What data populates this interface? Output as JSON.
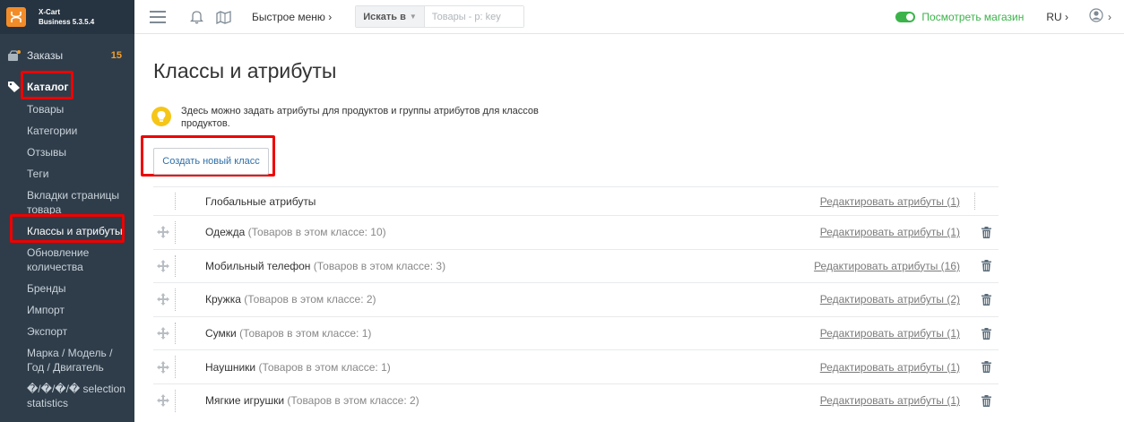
{
  "brand": {
    "name": "X-Cart",
    "edition": "Business 5.3.5.4"
  },
  "sidebar": {
    "orders_label": "Заказы",
    "orders_count": "15",
    "catalog_label": "Каталог",
    "items": [
      "Товары",
      "Категории",
      "Отзывы",
      "Теги",
      "Вкладки страницы товара",
      "Классы и атрибуты",
      "Обновление количества",
      "Бренды",
      "Импорт",
      "Экспорт",
      "Марка / Модель / Год / Двигатель",
      "�/�/�/� selection statistics"
    ],
    "active_item": "Классы и атрибуты"
  },
  "topbar": {
    "quick_menu": "Быстрое меню ›",
    "search_in": "Искать в",
    "search_placeholder": "Товары - p: key",
    "view_store": "Посмотреть магазин",
    "language": "RU ›"
  },
  "page": {
    "title": "Классы и атрибуты",
    "hint": "Здесь можно задать атрибуты для продуктов и группы атрибутов для классов продуктов.",
    "create_button": "Создать новый класс"
  },
  "classes": [
    {
      "name": "Глобальные атрибуты",
      "count_text": "",
      "edit": "Редактировать атрибуты (1)"
    },
    {
      "name": "Одежда",
      "count_text": "(Товаров в этом классе: 10)",
      "edit": "Редактировать атрибуты (1)"
    },
    {
      "name": "Мобильный телефон",
      "count_text": "(Товаров в этом классе: 3)",
      "edit": "Редактировать атрибуты (16)"
    },
    {
      "name": "Кружка",
      "count_text": "(Товаров в этом классе: 2)",
      "edit": "Редактировать атрибуты (2)"
    },
    {
      "name": "Сумки",
      "count_text": "(Товаров в этом классе: 1)",
      "edit": "Редактировать атрибуты (1)"
    },
    {
      "name": "Наушники",
      "count_text": "(Товаров в этом классе: 1)",
      "edit": "Редактировать атрибуты (1)"
    },
    {
      "name": "Мягкие игрушки",
      "count_text": "(Товаров в этом классе: 2)",
      "edit": "Редактировать атрибуты (1)"
    }
  ],
  "colors": {
    "sidebar_bg": "#2f3d4a",
    "accent_green": "#3bb34a",
    "highlight_red": "#e00000",
    "brand_orange": "#f28c28"
  }
}
